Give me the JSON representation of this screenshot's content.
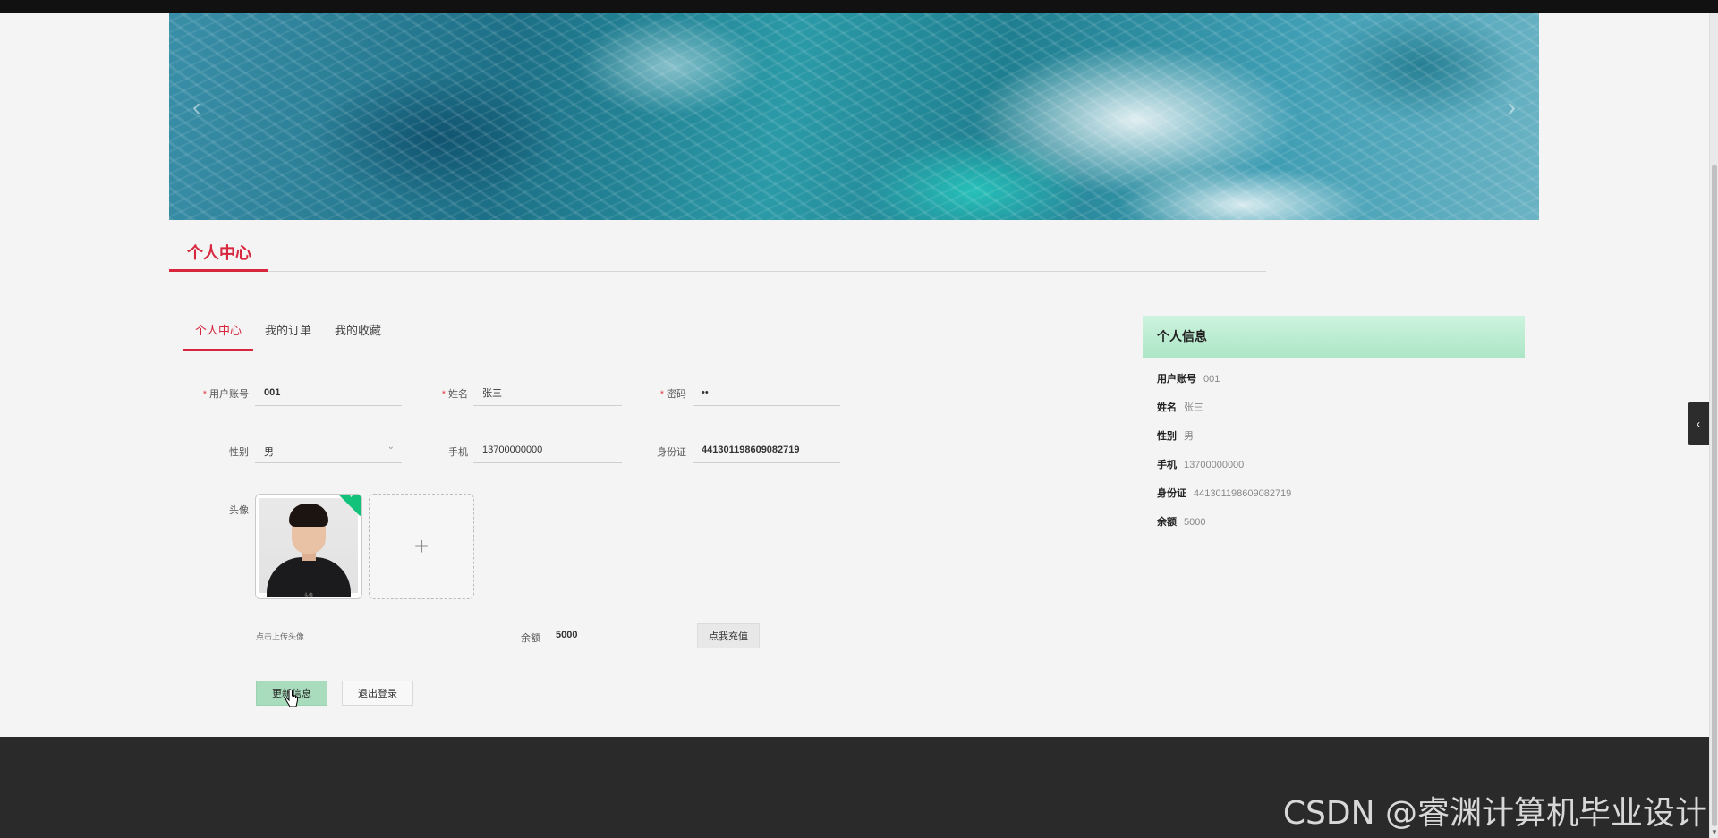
{
  "section": {
    "title": "个人中心"
  },
  "tabs": [
    {
      "label": "个人中心",
      "active": true
    },
    {
      "label": "我的订单",
      "active": false
    },
    {
      "label": "我的收藏",
      "active": false
    }
  ],
  "form": {
    "account": {
      "label": "用户账号",
      "value": "001",
      "required": true
    },
    "name": {
      "label": "姓名",
      "value": "张三",
      "required": true
    },
    "password": {
      "label": "密码",
      "value": "••",
      "required": true
    },
    "gender": {
      "label": "性别",
      "value": "男"
    },
    "phone": {
      "label": "手机",
      "value": "13700000000"
    },
    "id_card": {
      "label": "身份证",
      "value": "441301198609082719"
    },
    "avatar": {
      "label": "头像",
      "upload_hint": "点击上传头像",
      "caption": "头像"
    },
    "balance": {
      "label": "余额",
      "value": "5000"
    },
    "recharge_button": "点我充值",
    "update_button": "更新信息",
    "logout_button": "退出登录"
  },
  "info_panel": {
    "title": "个人信息",
    "rows": [
      {
        "key": "用户账号",
        "value": "001"
      },
      {
        "key": "姓名",
        "value": "张三"
      },
      {
        "key": "性别",
        "value": "男"
      },
      {
        "key": "手机",
        "value": "13700000000"
      },
      {
        "key": "身份证",
        "value": "441301198609082719"
      },
      {
        "key": "余额",
        "value": "5000"
      }
    ]
  },
  "icons": {
    "banner_prev": "chevron-left-icon",
    "banner_next": "chevron-right-icon",
    "select_chevron": "chevron-down-icon",
    "upload": "plus-icon",
    "side_handle": "chevron-left-icon",
    "avatar_badge": "check-icon"
  },
  "colors": {
    "accent_red": "#d7263d",
    "panel_green": "#ace6c6",
    "update_button_green": "#a8dcbc",
    "badge_green": "#13c27a",
    "footer": "#2a2a2a"
  },
  "watermark": "CSDN @睿渊计算机毕业设计"
}
